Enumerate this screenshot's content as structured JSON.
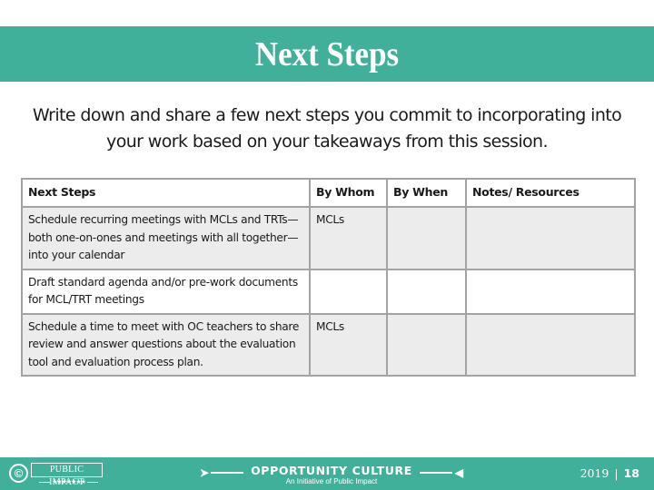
{
  "slide": {
    "title": "Next Steps",
    "intro": "Write down and share a few next steps you commit to incorporating into your work based on your takeaways from this session."
  },
  "table": {
    "headers": [
      "Next Steps",
      "By Whom",
      "By When",
      "Notes/ Resources"
    ],
    "rows": [
      {
        "step": "Schedule recurring meetings with MCLs and TRTs—both one-on-ones and meetings with all together—into your calendar",
        "by_whom": "MCLs",
        "by_when": "",
        "notes": ""
      },
      {
        "step": "Draft standard agenda and/or pre-work documents for MCL/TRT meetings",
        "by_whom": "",
        "by_when": "",
        "notes": ""
      },
      {
        "step": "Schedule a time to meet with OC teachers to share review and answer questions about the evaluation tool and evaluation process plan.",
        "by_whom": "MCLs",
        "by_when": "",
        "notes": ""
      }
    ]
  },
  "footer": {
    "copyright_symbol": "©",
    "public_impact_logo": "PUBLIC IMPACT",
    "public_impact_stars": "★★★★★★★",
    "oc_title": "OPPORTUNITY CULTURE",
    "oc_subtitle": "An Initiative of Public Impact",
    "oc_arrow_left": "➤",
    "oc_arrow_right": "◀",
    "year": "2019",
    "separator": "|",
    "page_number": "18"
  },
  "colors": {
    "brand_teal": "#41b09b",
    "row_shade": "#ececec",
    "border": "#a3a3a3"
  }
}
